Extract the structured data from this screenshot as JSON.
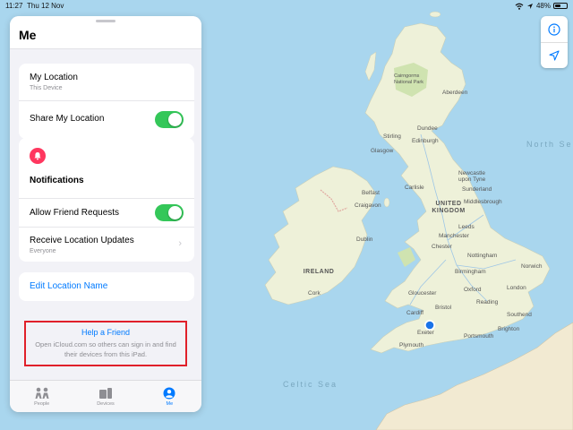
{
  "status_bar": {
    "time": "11:27",
    "date": "Thu 12 Nov",
    "battery": "48%",
    "battery_level": 0.48
  },
  "map": {
    "seas": [
      "North Se",
      "Celtic Sea"
    ],
    "countries": [
      "UNITED KINGDOM",
      "IRELAND"
    ],
    "cities": [
      "Cairngorms National Park",
      "Aberdeen",
      "Stirling",
      "Dundee",
      "Glasgow",
      "Edinburgh",
      "Belfast",
      "Craigavon",
      "Carlisle",
      "Newcastle upon Tyne",
      "Sunderland",
      "Middlesbrough",
      "Dublin",
      "Leeds",
      "Manchester",
      "Chester",
      "Nottingham",
      "Norwich",
      "Birmingham",
      "Cork",
      "Gloucester",
      "Oxford",
      "London",
      "Cardiff",
      "Bristol",
      "Reading",
      "Southend",
      "Exeter",
      "Portsmouth",
      "Brighton",
      "Plymouth"
    ],
    "colors": {
      "sea": "#a9d6ee",
      "land": "#eef1d9",
      "park": "#cfe3b0",
      "location_dot": "#1a73e8"
    }
  },
  "panel": {
    "title": "Me",
    "my_location": {
      "title": "My Location",
      "subtitle": "This Device"
    },
    "share_location": {
      "label": "Share My Location",
      "on": true
    },
    "notifications": {
      "heading": "Notifications",
      "icon": "bell-icon",
      "allow_friend_requests": {
        "label": "Allow Friend Requests",
        "on": true
      },
      "receive_updates": {
        "label": "Receive Location Updates",
        "value": "Everyone"
      }
    },
    "edit_location_name": "Edit Location Name",
    "help": {
      "title": "Help a Friend",
      "description": "Open iCloud.com so others can sign in and find their devices from this iPad."
    }
  },
  "tabs": [
    {
      "label": "People",
      "icon": "people-icon",
      "active": false
    },
    {
      "label": "Devices",
      "icon": "devices-icon",
      "active": false
    },
    {
      "label": "Me",
      "icon": "me-icon",
      "active": true
    }
  ],
  "accent_color": "#007aff",
  "toggle_color": "#34c759",
  "highlight_color": "#e0202a"
}
